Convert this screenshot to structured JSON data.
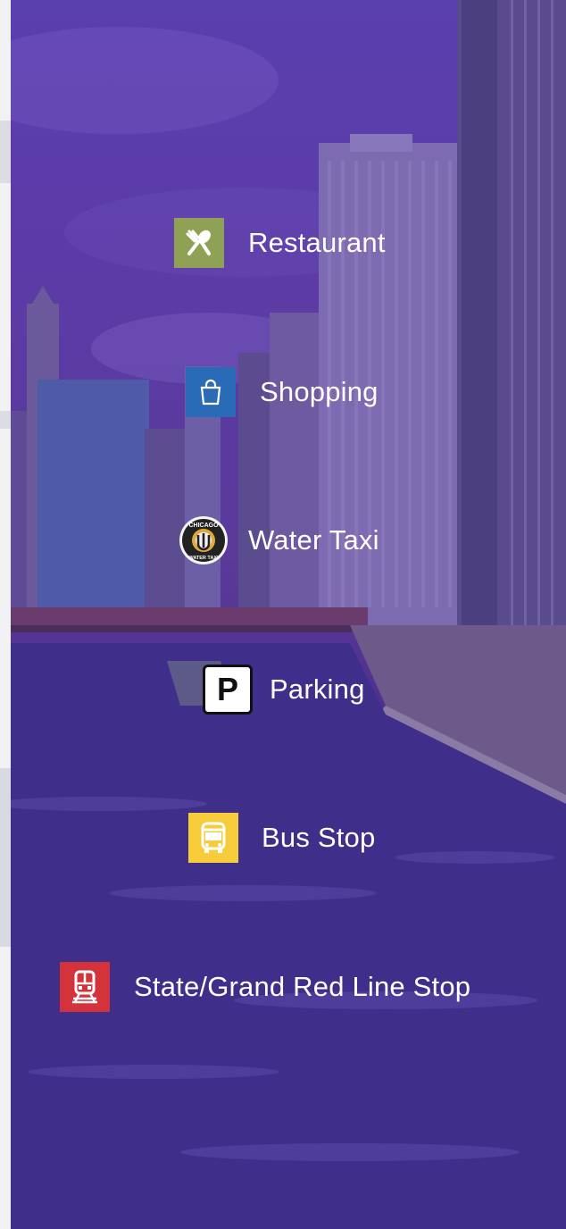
{
  "legend": {
    "items": [
      {
        "label": "Restaurant",
        "icon": "fork-spoon-icon",
        "color": "#8fa155"
      },
      {
        "label": "Shopping",
        "icon": "shopping-bag-icon",
        "color": "#2a6bb7"
      },
      {
        "label": "Water Taxi",
        "icon": "water-taxi-logo-icon",
        "color": "#f2f2f2"
      },
      {
        "label": "Parking",
        "icon": "parking-p-icon",
        "color": "#ffffff"
      },
      {
        "label": "Bus Stop",
        "icon": "bus-icon",
        "color": "#f7cc3b"
      },
      {
        "label": "State/Grand Red Line Stop",
        "icon": "train-icon",
        "color": "#d5333b"
      }
    ],
    "water_taxi_logo": {
      "top_text": "CHICAGO",
      "bottom_text": "WATER TAXI"
    },
    "parking_letter": "P"
  }
}
